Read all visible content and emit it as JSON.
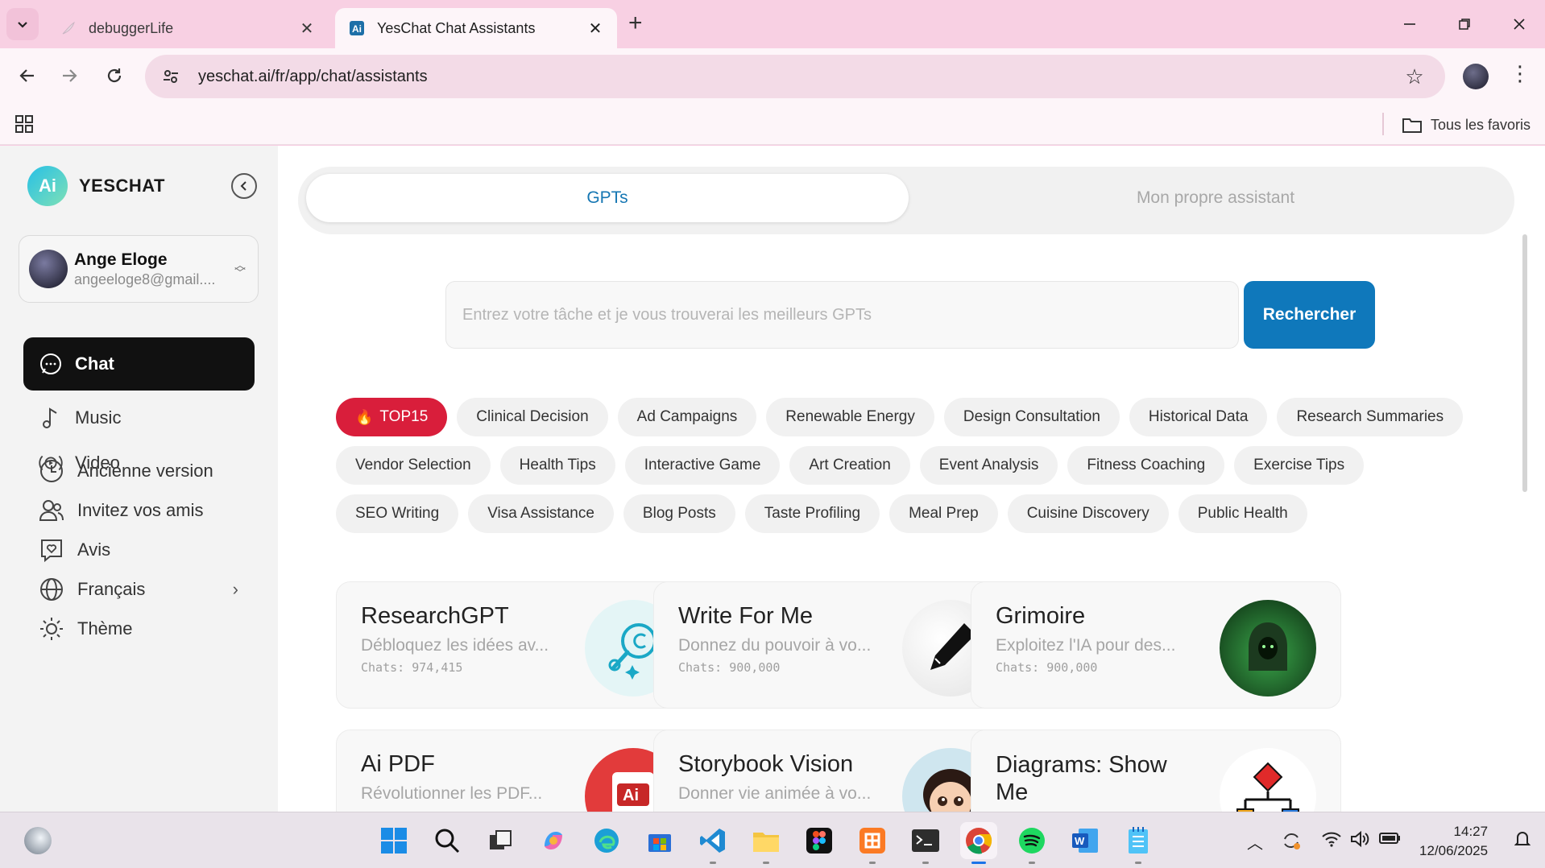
{
  "browser": {
    "tabs": [
      {
        "title": "debuggerLife",
        "active": false
      },
      {
        "title": "YesChat Chat Assistants",
        "active": true
      }
    ],
    "url": "yeschat.ai/fr/app/chat/assistants",
    "bookmarks_all": "Tous les favoris"
  },
  "sidebar": {
    "brand": "YESCHAT",
    "user": {
      "name": "Ange Eloge",
      "email": "angeeloge8@gmail...."
    },
    "nav": [
      {
        "label": "Chat",
        "icon": "chat-bubble-icon",
        "active": true
      },
      {
        "label": "Music",
        "icon": "music-note-icon",
        "active": false
      },
      {
        "label": "Video",
        "icon": "video-play-icon",
        "active": false
      }
    ],
    "bottom": [
      {
        "label": "Ancienne version",
        "icon": "clock-icon"
      },
      {
        "label": "Invitez vos amis",
        "icon": "users-icon"
      },
      {
        "label": "Avis",
        "icon": "heart-message-icon"
      },
      {
        "label": "Français",
        "icon": "globe-icon"
      },
      {
        "label": "Thème",
        "icon": "sun-icon"
      }
    ]
  },
  "main": {
    "tabs": {
      "gpts": "GPTs",
      "own": "Mon propre assistant"
    },
    "search": {
      "placeholder": "Entrez votre tâche et je vous trouverai les meilleurs GPTs",
      "button": "Rechercher"
    },
    "tags_rows": [
      [
        "TOP15",
        "Clinical Decision",
        "Ad Campaigns",
        "Renewable Energy",
        "Design Consultation",
        "Historical Data",
        "Research Summaries"
      ],
      [
        "Vendor Selection",
        "Health Tips",
        "Interactive Game",
        "Art Creation",
        "Event Analysis",
        "Fitness Coaching",
        "Exercise Tips"
      ],
      [
        "SEO Writing",
        "Visa Assistance",
        "Blog Posts",
        "Taste Profiling",
        "Meal Prep",
        "Cuisine Discovery",
        "Public Health"
      ]
    ],
    "cards": [
      {
        "title": "ResearchGPT",
        "desc": "Débloquez les idées av...",
        "chats": "Chats: 974,415"
      },
      {
        "title": "Write For Me",
        "desc": "Donnez du pouvoir à vo...",
        "chats": "Chats: 900,000"
      },
      {
        "title": "Grimoire",
        "desc": "Exploitez l'IA pour des...",
        "chats": "Chats: 900,000"
      },
      {
        "title": "Ai PDF",
        "desc": "Révolutionner les PDF...",
        "chats": ""
      },
      {
        "title": "Storybook Vision",
        "desc": "Donner vie animée à vo...",
        "chats": ""
      },
      {
        "title": "Diagrams: Show Me",
        "desc": "",
        "chats": ""
      }
    ]
  },
  "taskbar": {
    "time": "14:27",
    "date": "12/06/2025"
  },
  "colors": {
    "accent": "#0f78bb",
    "hot_tag": "#d91e3b",
    "chrome_pink": "#f8d0e3"
  }
}
